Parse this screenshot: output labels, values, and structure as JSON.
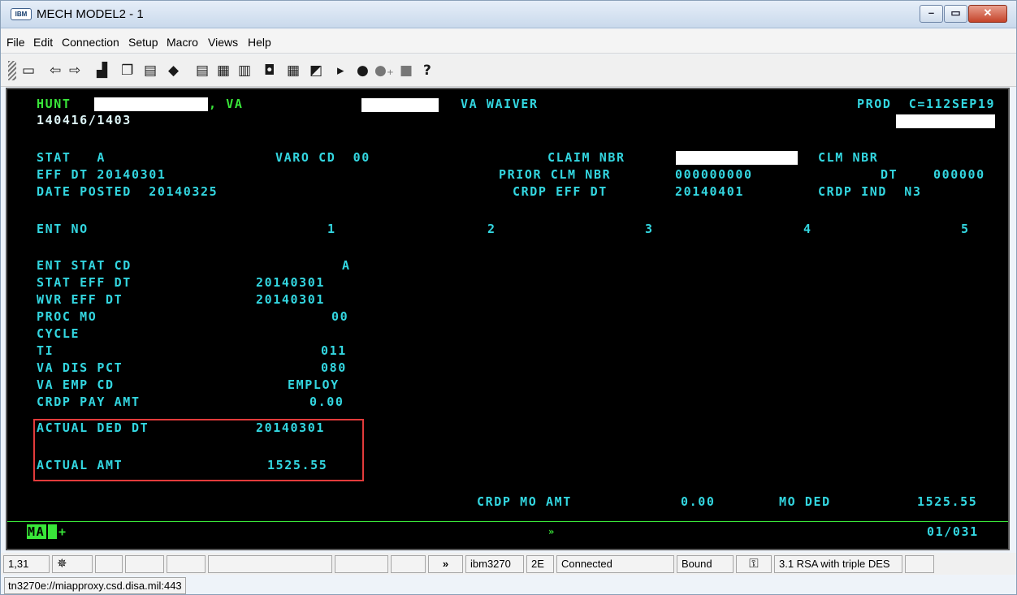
{
  "window": {
    "title": "MECH MODEL2 - 1",
    "icon_label": "IBM"
  },
  "menu": [
    "File",
    "Edit",
    "Connection",
    "Setup",
    "Macro",
    "Views",
    "Help"
  ],
  "toolbar_icons": [
    "screen-icon",
    "back-arrow-icon",
    "forward-arrow-icon",
    "print-icon",
    "copy-icon",
    "paste-icon",
    "eraser-icon",
    "display-icon",
    "keypad-icon",
    "keyboard-icon",
    "mouse-icon",
    "grid-icon",
    "send-icon",
    "play-icon",
    "record-icon",
    "record-plus-icon",
    "stop-icon",
    "help-icon"
  ],
  "help_glyph": "?",
  "header": {
    "left": "HUNT",
    "state": ", VA",
    "program": "VA WAIVER",
    "right": "PROD  C=112SEP19",
    "session_id": "140416/1403"
  },
  "top_fields": {
    "stat_label": "STAT   A",
    "varo_label": "VARO CD  00",
    "claim_nbr_label": "CLAIM NBR",
    "clm_nbr_label": "CLM NBR",
    "eff_dt": "EFF DT 20140301",
    "prior_clm_nbr_label": "PRIOR CLM NBR",
    "prior_clm_nbr_value": "000000000",
    "dt_label": "DT",
    "dt_value": "000000",
    "date_posted": "DATE POSTED  20140325",
    "crdp_eff_dt_label": "CRDP EFF DT",
    "crdp_eff_dt_value": "20140401",
    "crdp_ind": "CRDP IND  N3"
  },
  "ent_no": {
    "label": "ENT NO",
    "cols": [
      "1",
      "2",
      "3",
      "4",
      "5"
    ]
  },
  "entry_fields": [
    {
      "label": "ENT STAT CD",
      "value": "A"
    },
    {
      "label": "STAT EFF DT",
      "value": "20140301"
    },
    {
      "label": "WVR EFF DT",
      "value": "20140301"
    },
    {
      "label": "PROC MO",
      "value": "00"
    },
    {
      "label": "CYCLE",
      "value": ""
    },
    {
      "label": "TI",
      "value": "011"
    },
    {
      "label": "VA DIS PCT",
      "value": "080"
    },
    {
      "label": "VA EMP CD",
      "value": "EMPLOY"
    },
    {
      "label": "CRDP PAY AMT",
      "value": "0.00"
    },
    {
      "label": "ACTUAL DED DT",
      "value": "20140301"
    },
    {
      "label": "ACTUAL AMT",
      "value": "1525.55"
    }
  ],
  "footer": {
    "crdp_mo_amt_label": "CRDP MO AMT",
    "crdp_mo_amt_value": "0.00",
    "mo_ded_label": "MO DED",
    "mo_ded_value": "1525.55"
  },
  "oia": {
    "mode": "MA",
    "plus": "+",
    "arrows": "»",
    "position": "01/031"
  },
  "status": {
    "cursor": "1,31",
    "icon_glyph": "✵",
    "arrows": "»",
    "terminal_type": "ibm3270",
    "model": "2E",
    "connection": "Connected",
    "bound": "Bound",
    "key_glyph": "⚿",
    "encryption": "3.1 RSA with triple DES"
  },
  "url": "tn3270e://miapproxy.csd.disa.mil:443",
  "colors": {
    "terminal_text": "#33d6e0",
    "terminal_green": "#39e639",
    "terminal_bg": "#000000",
    "highlight_box": "#e23b3b"
  }
}
